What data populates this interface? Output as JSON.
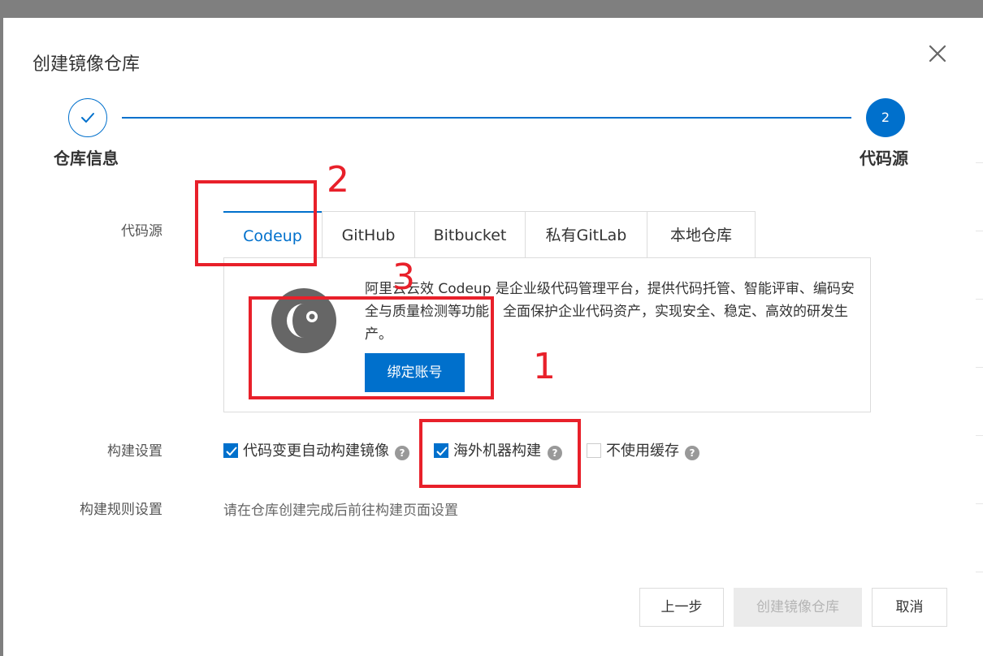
{
  "dialog": {
    "title": "创建镜像仓库",
    "close_icon": "close-icon"
  },
  "stepper": {
    "steps": [
      {
        "label": "仓库信息",
        "state": "done",
        "marker_icon": "check-icon"
      },
      {
        "label": "代码源",
        "state": "active",
        "number": "2"
      }
    ],
    "accent": "#0070cc"
  },
  "form": {
    "source_label": "代码源",
    "build_settings_label": "构建设置",
    "build_rules_label": "构建规则设置",
    "build_rules_text": "请在仓库创建完成后前往构建页面设置"
  },
  "tabs": [
    {
      "label": "Codeup",
      "active": true
    },
    {
      "label": "GitHub",
      "active": false
    },
    {
      "label": "Bitbucket",
      "active": false
    },
    {
      "label": "私有GitLab",
      "active": false
    },
    {
      "label": "本地仓库",
      "active": false
    }
  ],
  "codeup_panel": {
    "logo_icon": "codeup-logo",
    "description": "阿里云云效 Codeup 是企业级代码管理平台，提供代码托管、智能评审、编码安全与质量检测等功能，全面保护企业代码资产，实现安全、稳定、高效的研发生产。",
    "bind_button": "绑定账号"
  },
  "build_options": [
    {
      "label": "代码变更自动构建镜像",
      "checked": true,
      "help_icon": "help-icon"
    },
    {
      "label": "海外机器构建",
      "checked": true,
      "help_icon": "help-icon"
    },
    {
      "label": "不使用缓存",
      "checked": false,
      "help_icon": "help-icon"
    }
  ],
  "footer": {
    "prev_button": "上一步",
    "create_button": "创建镜像仓库",
    "cancel_button": "取消"
  },
  "annotations": [
    "1",
    "2",
    "3"
  ],
  "colors": {
    "accent": "#0070cc",
    "annotation": "#e8202a",
    "disabled_bg": "#ebebeb"
  }
}
